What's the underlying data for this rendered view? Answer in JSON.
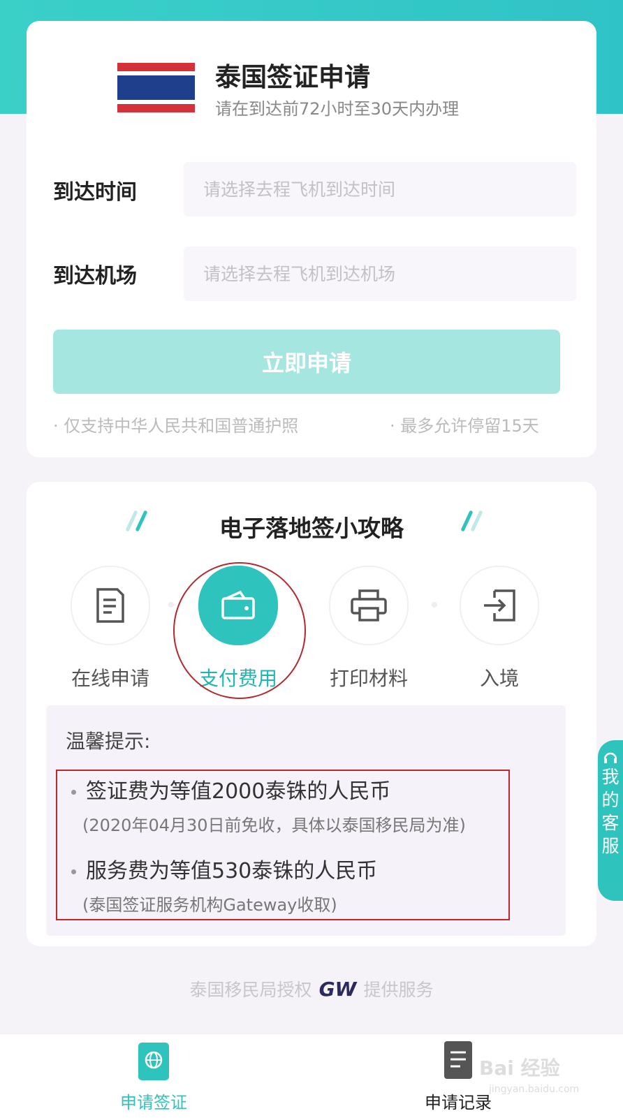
{
  "header": {
    "title": "泰国签证申请",
    "subtitle": "请在到达前72小时至30天内办理"
  },
  "form": {
    "arrival_time": {
      "label": "到达时间",
      "placeholder": "请选择去程飞机到达时间",
      "value": ""
    },
    "arrival_airport": {
      "label": "到达机场",
      "placeholder": "请选择去程飞机到达机场",
      "value": ""
    },
    "apply_button": "立即申请",
    "notes": [
      "· 仅支持中华人民共和国普通护照",
      "· 最多允许停留15天"
    ]
  },
  "guide": {
    "title": "电子落地签小攻略",
    "steps": [
      {
        "label": "在线申请",
        "icon": "document-icon",
        "active": false
      },
      {
        "label": "支付费用",
        "icon": "wallet-icon",
        "active": true
      },
      {
        "label": "打印材料",
        "icon": "printer-icon",
        "active": false
      },
      {
        "label": "入境",
        "icon": "entry-icon",
        "active": false
      }
    ],
    "tips": {
      "title": "温馨提示:",
      "items": [
        {
          "main": "签证费为等值2000泰铢的人民币",
          "sub": "(2020年04月30日前免收，具体以泰国移民局为准)"
        },
        {
          "main": "服务费为等值530泰铢的人民币",
          "sub": "(泰国签证服务机构Gateway收取)"
        }
      ]
    }
  },
  "footer": {
    "left": "泰国移民局授权",
    "logo": "GW",
    "right": "提供服务"
  },
  "side_service": [
    "我",
    "的",
    "客",
    "服"
  ],
  "tabbar": [
    {
      "label": "申请签证",
      "icon": "passport-icon",
      "active": true
    },
    {
      "label": "申请记录",
      "icon": "record-icon",
      "active": false
    }
  ],
  "watermark": {
    "text": "Bai 经验",
    "sub": "jingyan.baidu.com"
  },
  "colors": {
    "accent": "#2fc3be",
    "header_band": "#3ad0c8",
    "highlight_annotation": "#c4262d",
    "flag_red": "#d4323a",
    "flag_blue": "#1f3f8c"
  }
}
